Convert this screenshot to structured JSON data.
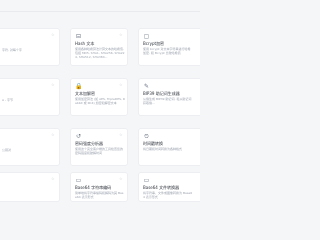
{
  "cards": [
    {
      "id": "l1",
      "title": "",
      "desc": "字符, 对每个字",
      "icon": "",
      "fav": "☆"
    },
    {
      "id": "c1",
      "title": "Hash 文本",
      "desc": "使用各种哈希算法计算文本的哈希值, 包括 MD5, SHA1, SHA256, SHA224, SHA512, SHA384...",
      "icon": "⊟",
      "fav": "☆"
    },
    {
      "id": "r1",
      "title": "Bcrypt加密",
      "desc": "使用 bcrypt 对文本字符串进行哈希加密, 和 Bcrypt 比较哈希值",
      "icon": "▢",
      "fav": "☆"
    },
    {
      "id": "l2",
      "title": "",
      "desc": "A - 字节",
      "icon": "",
      "fav": "☆"
    },
    {
      "id": "c2",
      "title": "文本加解密",
      "desc": "使用加密算法 (如 AES, TripleDES, Rabbit 或 RC4) 加密和解密文本",
      "icon": "🔒",
      "fav": "☆"
    },
    {
      "id": "r2",
      "title": "BIP39 助记词生成器",
      "desc": "从熵生成 BIP39 助记词, 和从助记词获取熵...",
      "icon": "✎",
      "fav": "☆"
    },
    {
      "id": "l3",
      "title": "",
      "desc": "公钥对",
      "icon": "",
      "fav": "☆"
    },
    {
      "id": "c3",
      "title": "密码强度分析器",
      "desc": "使用这个完全客户端的工具检查您的密码强度和破解时间",
      "icon": "↺",
      "fav": "☆"
    },
    {
      "id": "r3",
      "title": "时间戳转换",
      "desc": "将日期和时间转换为各种格式",
      "icon": "⏲",
      "fav": "☆"
    },
    {
      "id": "l4",
      "title": "",
      "desc": "",
      "icon": "",
      "fav": "☆"
    },
    {
      "id": "c4",
      "title": "Base64 字符串编码",
      "desc": "简单地将字符串编码和解码为其 Base64 表示形式",
      "icon": "▭",
      "fav": "☆"
    },
    {
      "id": "r4",
      "title": "Base64 文件转换器",
      "desc": "将字符串、文件或图像转换为 Base64 表示形式",
      "icon": "▭",
      "fav": "☆"
    }
  ]
}
